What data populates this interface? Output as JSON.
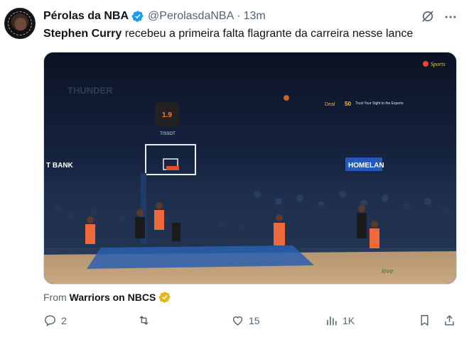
{
  "author": {
    "name": "Pérolas da NBA",
    "handle": "@PerolasdaNBA",
    "separator": "·",
    "time": "13m"
  },
  "tweet": {
    "bold": "Stephen Curry",
    "text": " recebeu a primeira falta flagrante da carreira nesse lance"
  },
  "media": {
    "network_logo": "Sports",
    "arena_sign": "THUNDER",
    "shot_clock": "1.9",
    "clock_brand": "TISSOT",
    "bank_sign": "T BANK",
    "home_sign": "HOMELAN",
    "ribbon": "Trust Your Sight to the Experts",
    "ribbon_num": "50",
    "deal": "Deal",
    "court_text": "leve"
  },
  "caption": {
    "prefix": "From",
    "source": "Warriors on NBCS"
  },
  "actions": {
    "replies": "2",
    "reposts": "",
    "likes": "15",
    "views": "1K"
  }
}
